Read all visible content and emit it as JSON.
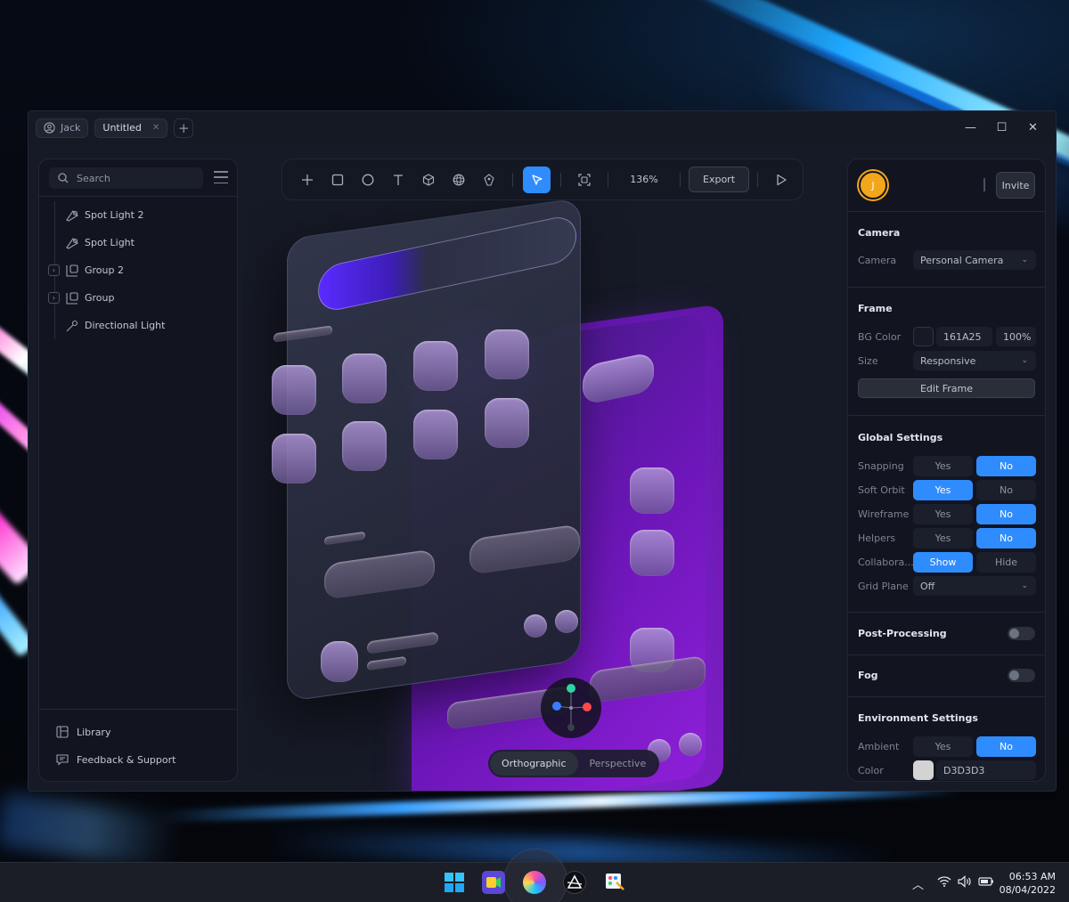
{
  "window": {
    "user_tab": "Jack",
    "doc_tab": "Untitled",
    "new_tab": "+",
    "controls": {
      "minimize": "—",
      "maximize": "☐",
      "close": "✕"
    }
  },
  "left_panel": {
    "search_placeholder": "Search",
    "layers": [
      {
        "label": "Spot Light 2",
        "icon": "spotlight-icon",
        "expandable": false
      },
      {
        "label": "Spot Light",
        "icon": "spotlight-icon",
        "expandable": false
      },
      {
        "label": "Group 2",
        "icon": "group-icon",
        "expandable": true
      },
      {
        "label": "Group",
        "icon": "group-icon",
        "expandable": true
      },
      {
        "label": "Directional Light",
        "icon": "directional-light-icon",
        "expandable": false
      }
    ],
    "library": "Library",
    "feedback": "Feedback & Support"
  },
  "toolbar": {
    "tools": [
      "add-icon",
      "rectangle-icon",
      "ellipse-icon",
      "text-icon",
      "cube-icon",
      "sphere-icon",
      "material-icon",
      "select-icon",
      "frame-icon"
    ],
    "selected_tool": "select-icon",
    "zoom": "136%",
    "export_label": "Export",
    "play_icon": "play-icon"
  },
  "canvas": {
    "view_modes": [
      "Orthographic",
      "Perspective"
    ],
    "active_view": "Orthographic"
  },
  "right_panel": {
    "avatar_initial": "J",
    "avatar_color": "#f3a61b",
    "invite_label": "Invite",
    "camera": {
      "title": "Camera",
      "label": "Camera",
      "value": "Personal Camera"
    },
    "frame": {
      "title": "Frame",
      "bg_label": "BG Color",
      "bg_hex": "161A25",
      "bg_opacity": "100%",
      "bg_swatch": "#161a25",
      "size_label": "Size",
      "size_value": "Responsive",
      "edit_button": "Edit Frame"
    },
    "global": {
      "title": "Global Settings",
      "rows": [
        {
          "label": "Snapping",
          "a": "Yes",
          "b": "No",
          "on": "b"
        },
        {
          "label": "Soft Orbit",
          "a": "Yes",
          "b": "No",
          "on": "a"
        },
        {
          "label": "Wireframe",
          "a": "Yes",
          "b": "No",
          "on": "b"
        },
        {
          "label": "Helpers",
          "a": "Yes",
          "b": "No",
          "on": "b"
        },
        {
          "label": "Collabora...",
          "a": "Show",
          "b": "Hide",
          "on": "a"
        }
      ],
      "grid_label": "Grid Plane",
      "grid_value": "Off"
    },
    "post_processing": {
      "title": "Post-Processing",
      "enabled": false
    },
    "fog": {
      "title": "Fog",
      "enabled": false
    },
    "environment": {
      "title": "Environment Settings",
      "ambient_label": "Ambient",
      "ambient_yes": "Yes",
      "ambient_no": "No",
      "ambient_on": "b",
      "color_label": "Color",
      "color_hex": "D3D3D3",
      "color_swatch": "#d3d3d3"
    }
  },
  "taskbar": {
    "apps": [
      "windows-start-icon",
      "meet-icon",
      "spline-icon",
      "affinity-icon",
      "paint-icon"
    ],
    "time": "06:53 AM",
    "date": "08/04/2022",
    "accent": "#2f8cff"
  }
}
